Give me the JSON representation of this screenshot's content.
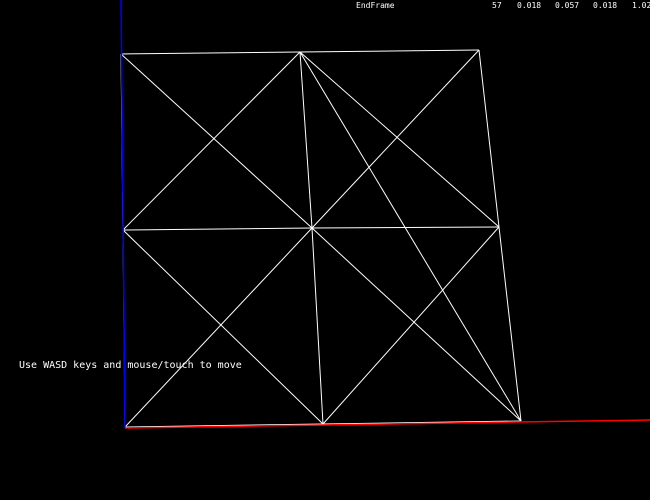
{
  "colors": {
    "background": "#000000",
    "wireframe": "#ffffff",
    "x_axis": "#ff0000",
    "y_axis": "#0000ff",
    "text": "#ffffff"
  },
  "profiler": {
    "name": "EndFrame",
    "count": "57",
    "values": [
      "0.018",
      "0.057",
      "0.018",
      "1.02"
    ]
  },
  "instructions": "Use WASD keys and mouse/touch to move"
}
